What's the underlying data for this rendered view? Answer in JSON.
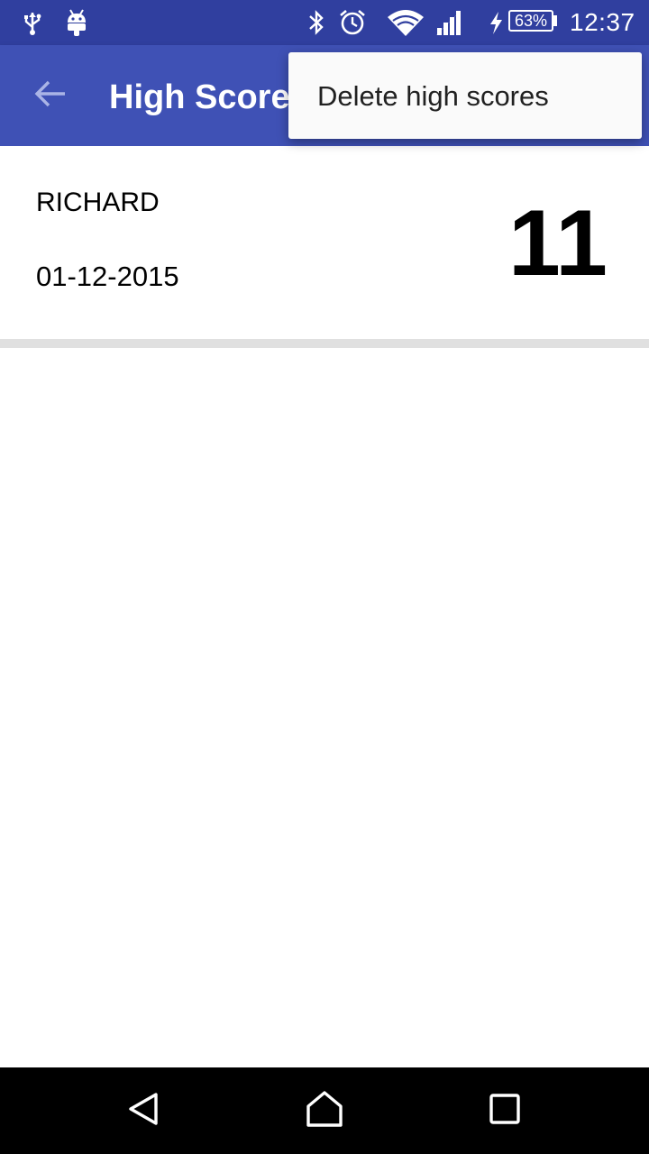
{
  "status_bar": {
    "left_icons": [
      "usb-icon",
      "android-debug-icon"
    ],
    "right_icons": [
      "bluetooth-icon",
      "alarm-icon",
      "wifi-icon",
      "cell-signal-icon",
      "charging-icon"
    ],
    "battery_percent": "63%",
    "time": "12:37"
  },
  "app_bar": {
    "title": "High Scores",
    "back_icon": "arrow-back-icon"
  },
  "overflow_menu": {
    "items": [
      {
        "label": "Delete high scores"
      }
    ]
  },
  "scores": [
    {
      "name": "RICHARD",
      "date": "01-12-2015",
      "score": "11"
    }
  ],
  "nav_bar": {
    "icons": [
      "back-triangle-icon",
      "home-icon",
      "recents-icon"
    ]
  },
  "colors": {
    "status_bar": "#303f9f",
    "app_bar": "#3f51b5",
    "menu_bg": "#fafafa",
    "divider": "#e0e0e0",
    "nav_bar": "#000000"
  }
}
